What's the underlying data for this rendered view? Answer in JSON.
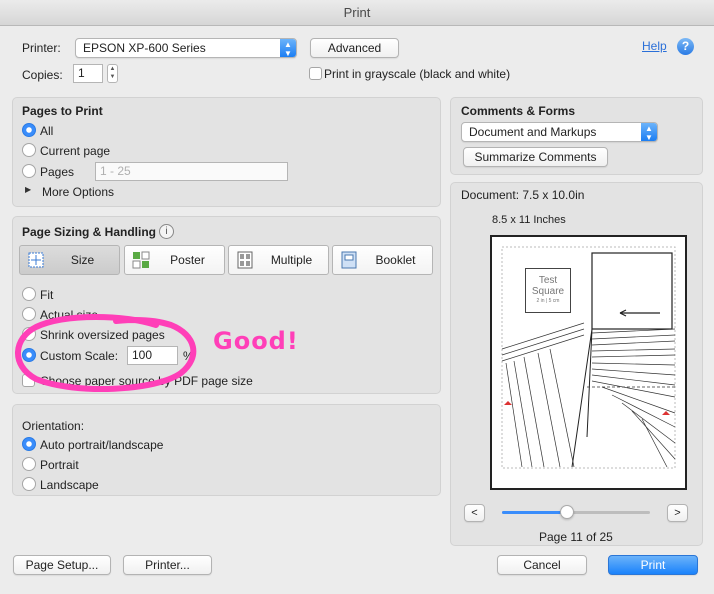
{
  "window": {
    "title": "Print"
  },
  "printer": {
    "label": "Printer:",
    "value": "EPSON XP-600 Series",
    "advanced": "Advanced",
    "help": "Help",
    "copies_label": "Copies:",
    "copies": "1",
    "grayscale": "Print in grayscale (black and white)"
  },
  "pages_to_print": {
    "title": "Pages to Print",
    "all": "All",
    "current": "Current page",
    "pages": "Pages",
    "pages_placeholder": "1 - 25",
    "more": "More Options"
  },
  "sizing": {
    "title": "Page Sizing & Handling",
    "tabs": [
      "Size",
      "Poster",
      "Multiple",
      "Booklet"
    ],
    "fit": "Fit",
    "actual": "Actual size",
    "shrink": "Shrink oversized pages",
    "custom": "Custom Scale:",
    "custom_value": "100",
    "percent": "%",
    "paper_source": "Choose paper source by PDF page size"
  },
  "orientation": {
    "title": "Orientation:",
    "auto": "Auto portrait/landscape",
    "portrait": "Portrait",
    "landscape": "Landscape"
  },
  "comments": {
    "title": "Comments & Forms",
    "value": "Document and Markups",
    "summarize": "Summarize Comments"
  },
  "preview": {
    "document": "Document: 7.5 x 10.0in",
    "paper": "8.5 x 11 Inches",
    "test_square_1": "Test",
    "test_square_2": "Square",
    "test_square_3": "2 in | 5 cm",
    "prev": "<",
    "next": ">",
    "page_status": "Page 11 of 25",
    "slider_fraction": 0.44
  },
  "annotation": {
    "text": "Good!",
    "color": "#ff3fb8"
  },
  "footer": {
    "page_setup": "Page Setup...",
    "printer": "Printer...",
    "cancel": "Cancel",
    "print": "Print"
  },
  "colors": {
    "accent": "#1a82fb",
    "link": "#2a6fd8"
  }
}
